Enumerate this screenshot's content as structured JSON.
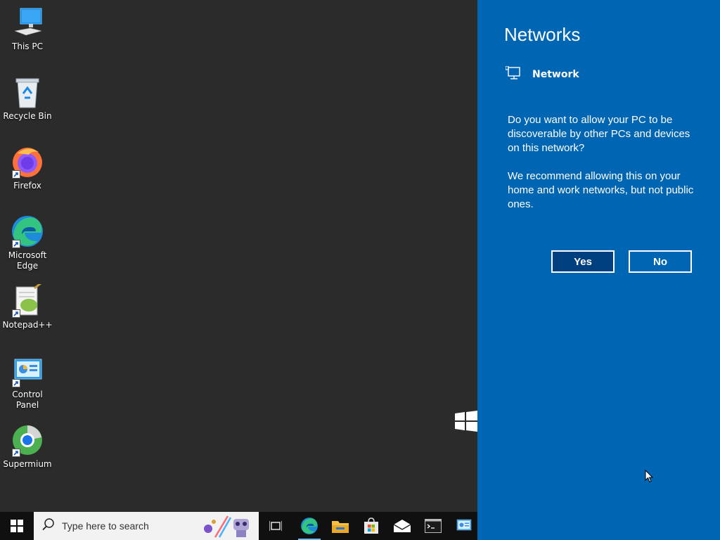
{
  "desktop": {
    "icons": [
      {
        "label": "This PC",
        "icon": "this-pc-icon",
        "shortcut": false
      },
      {
        "label": "Recycle Bin",
        "icon": "recycle-bin-icon",
        "shortcut": false
      },
      {
        "label": "Firefox",
        "icon": "firefox-icon",
        "shortcut": true
      },
      {
        "label": "Microsoft\nEdge",
        "icon": "edge-icon",
        "shortcut": true
      },
      {
        "label": "Notepad++",
        "icon": "notepadpp-icon",
        "shortcut": true
      },
      {
        "label": "Control Panel",
        "icon": "control-panel-icon",
        "shortcut": true
      },
      {
        "label": "Supermium",
        "icon": "supermium-icon",
        "shortcut": true
      }
    ]
  },
  "flyout": {
    "title": "Networks",
    "network_name": "Network",
    "message1": "Do you want to allow your PC to be discoverable by other PCs and devices on this network?",
    "message2": "We recommend allowing this on your home and work networks, but not public ones.",
    "yes_label": "Yes",
    "no_label": "No",
    "accent": "#0066b3",
    "yes_bg": "#003f7f"
  },
  "taskbar": {
    "search_placeholder": "Type here to search",
    "pinned": [
      "task-view-icon",
      "edge-icon",
      "file-explorer-icon",
      "store-icon",
      "mail-icon",
      "terminal-icon",
      "control-panel-icon"
    ]
  }
}
